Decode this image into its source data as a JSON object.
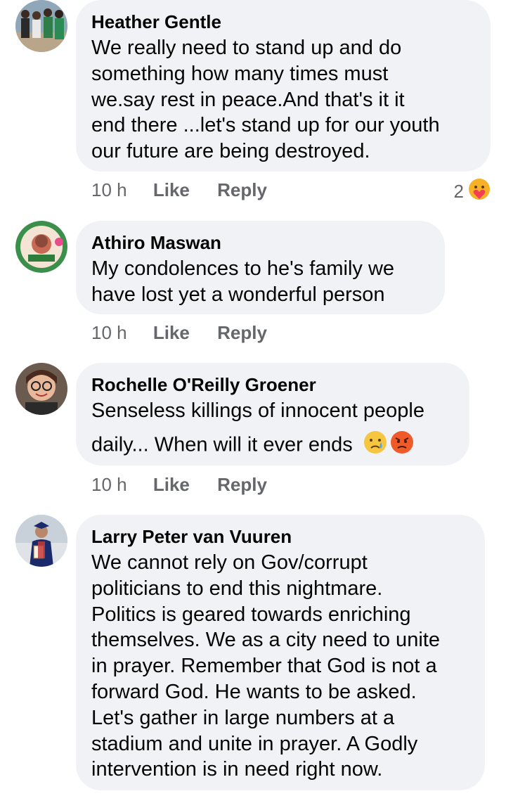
{
  "comments": [
    {
      "author": "Heather Gentle",
      "lines": [
        "We really need to stand up and do",
        "something how many times must",
        "we.say rest in peace.And that's it it",
        "end there ...let's stand up for our youth",
        "our future are being destroyed."
      ],
      "time": "10 h",
      "like_label": "Like",
      "reply_label": "Reply",
      "reaction_count": "2",
      "reaction_icon": "care-reaction-icon"
    },
    {
      "author": "Athiro Maswan",
      "lines": [
        "My condolences to he's  family we",
        "have lost yet a wonderful person"
      ],
      "time": "10 h",
      "like_label": "Like",
      "reply_label": "Reply"
    },
    {
      "author": "Rochelle O'Reilly Groener",
      "lines": [
        "Senseless killings of innocent people",
        "daily... When will it ever ends"
      ],
      "emojis": [
        "crying-face-emoji",
        "angry-face-emoji"
      ],
      "time": "10 h",
      "like_label": "Like",
      "reply_label": "Reply"
    },
    {
      "author": "Larry Peter van Vuuren",
      "lines": [
        "We cannot rely on Gov/corrupt",
        "politicians to end this nightmare.",
        "Politics is geared towards enriching",
        "themselves. We as a city need to unite",
        "in prayer. Remember that God is not a",
        "forward God. He wants to be asked.",
        "Let's gather in large numbers at a",
        "stadium and unite in prayer. A Godly",
        "intervention is in need right now."
      ]
    }
  ],
  "colors": {
    "bubble": "#f0f2f5",
    "meta_text": "#65676b",
    "text": "#050505"
  }
}
